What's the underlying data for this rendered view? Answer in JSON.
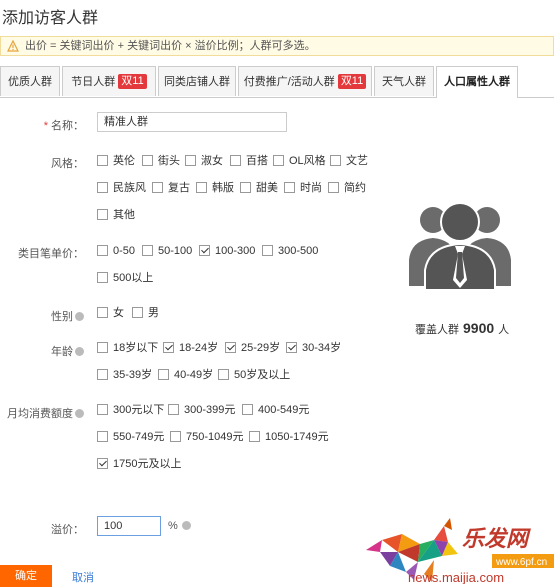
{
  "header": {
    "title": "添加访客人群"
  },
  "notice": {
    "text": "出价 = 关键词出价 + 关键词出价 × 溢价比例；人群可多选。"
  },
  "tabs": [
    {
      "label": "优质人群"
    },
    {
      "label": "节日人群",
      "badge": "双11"
    },
    {
      "label": "同类店铺人群"
    },
    {
      "label": "付费推广/活动人群",
      "badge": "双11"
    },
    {
      "label": "天气人群"
    },
    {
      "label": "人口属性人群"
    }
  ],
  "form": {
    "name_label": "名称：",
    "name_required_mark": "*",
    "name_value": "精准人群",
    "style_label": "风格：",
    "style_options": [
      {
        "label": "英伦",
        "checked": false
      },
      {
        "label": "街头",
        "checked": false
      },
      {
        "label": "淑女",
        "checked": false
      },
      {
        "label": "百搭",
        "checked": false
      },
      {
        "label": "OL风格",
        "checked": false
      },
      {
        "label": "文艺",
        "checked": false
      },
      {
        "label": "民族风",
        "checked": false
      },
      {
        "label": "复古",
        "checked": false
      },
      {
        "label": "韩版",
        "checked": false
      },
      {
        "label": "甜美",
        "checked": false
      },
      {
        "label": "时尚",
        "checked": false
      },
      {
        "label": "简约",
        "checked": false
      },
      {
        "label": "其他",
        "checked": false
      }
    ],
    "price_label": "类目笔单价：",
    "price_options": [
      {
        "label": "0-50",
        "checked": false
      },
      {
        "label": "50-100",
        "checked": false
      },
      {
        "label": "100-300",
        "checked": true
      },
      {
        "label": "300-500",
        "checked": false
      },
      {
        "label": "500以上",
        "checked": false
      }
    ],
    "gender_label": "性别",
    "gender_options": [
      {
        "label": "女",
        "checked": false
      },
      {
        "label": "男",
        "checked": false
      }
    ],
    "age_label": "年龄",
    "age_options": [
      {
        "label": "18岁以下",
        "checked": false
      },
      {
        "label": "18-24岁",
        "checked": true
      },
      {
        "label": "25-29岁",
        "checked": true
      },
      {
        "label": "30-34岁",
        "checked": true
      },
      {
        "label": "35-39岁",
        "checked": false
      },
      {
        "label": "40-49岁",
        "checked": false
      },
      {
        "label": "50岁及以上",
        "checked": false
      }
    ],
    "spend_label": "月均消费额度",
    "spend_options": [
      {
        "label": "300元以下",
        "checked": false
      },
      {
        "label": "300-399元",
        "checked": false
      },
      {
        "label": "400-549元",
        "checked": false
      },
      {
        "label": "550-749元",
        "checked": false
      },
      {
        "label": "750-1049元",
        "checked": false
      },
      {
        "label": "1050-1749元",
        "checked": false
      },
      {
        "label": "1750元及以上",
        "checked": true
      }
    ],
    "premium_label": "溢价：",
    "premium_value": "100",
    "premium_unit": "%"
  },
  "coverage": {
    "prefix": "覆盖人群",
    "count": "9900",
    "unit": "人"
  },
  "actions": {
    "confirm": "确定",
    "cancel": "取消"
  },
  "watermark": {
    "brand": "乐发网",
    "url": "news.maijia.com",
    "site": "www.6pf.cn"
  },
  "colors": {
    "accent": "#ff6600",
    "badge": "#e4393c",
    "link": "#3a7bd5",
    "notice_bg": "#fffbe5"
  }
}
